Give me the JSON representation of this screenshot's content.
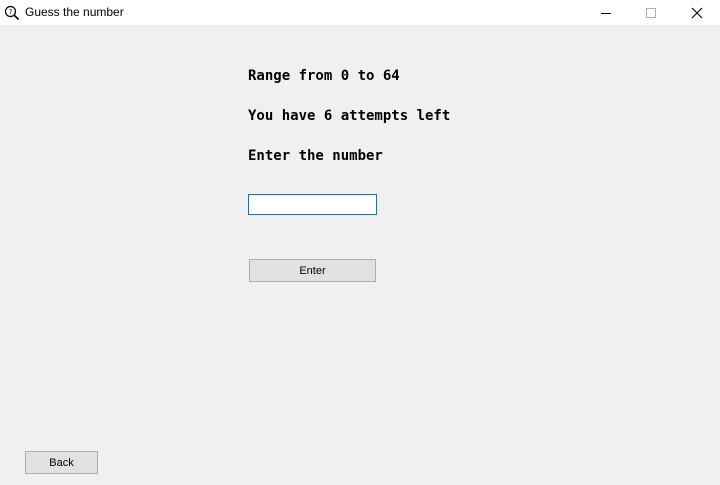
{
  "window": {
    "title": "Guess the number",
    "icon": "magnifier-question-icon"
  },
  "labels": {
    "range": "Range from 0 to 64",
    "attempts": "You have 6 attempts left",
    "prompt": "Enter the number"
  },
  "number_input": {
    "value": "",
    "placeholder": ""
  },
  "buttons": {
    "enter": "Enter",
    "back": "Back"
  },
  "colors": {
    "input_border_focus": "#0078d7",
    "background": "#f0f0f0"
  }
}
